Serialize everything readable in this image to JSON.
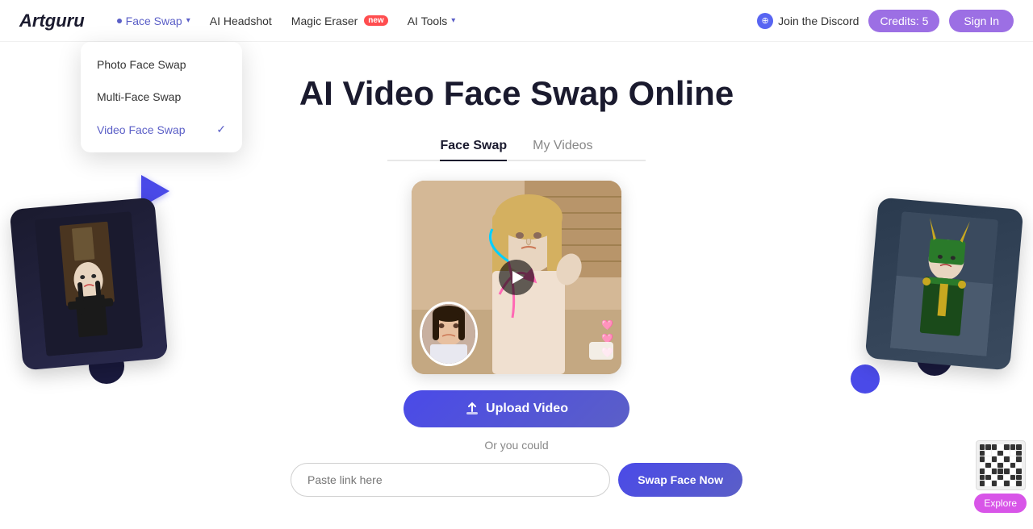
{
  "header": {
    "logo": "Artguru",
    "nav": [
      {
        "label": "Face Swap",
        "active": true,
        "has_dropdown": true,
        "has_dot": true
      },
      {
        "label": "AI Headshot",
        "active": false
      },
      {
        "label": "Magic Eraser",
        "active": false,
        "badge": "new"
      },
      {
        "label": "AI Tools",
        "active": false,
        "has_chevron": true
      }
    ],
    "discord_label": "Join the Discord",
    "credits_label": "Credits: 5",
    "signin_label": "Sign In"
  },
  "dropdown": {
    "items": [
      {
        "label": "Photo Face Swap",
        "active": false
      },
      {
        "label": "Multi-Face Swap",
        "active": false
      },
      {
        "label": "Video Face Swap",
        "active": true
      }
    ]
  },
  "main": {
    "title": "AI Video Face Swap Online",
    "tabs": [
      {
        "label": "Face Swap",
        "active": true
      },
      {
        "label": "My Videos",
        "active": false
      }
    ],
    "upload_btn": "Upload Video",
    "or_text": "Or you could",
    "paste_placeholder": "Paste link here",
    "swap_btn": "Swap Face Now",
    "explore_btn": "Explore"
  }
}
